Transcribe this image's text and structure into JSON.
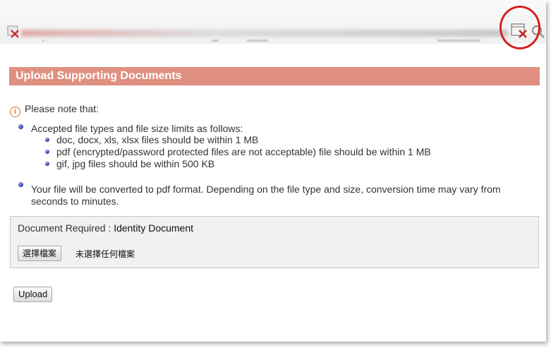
{
  "dialog": {
    "title": "Upload Supporting Documents",
    "note_prefix": "Please note that:"
  },
  "list": {
    "item1": "Accepted file types and file size limits as follows:",
    "sub_items": [
      "doc, docx, xls, xlsx files should be within 1 MB",
      "pdf (encrypted/password protected files are not acceptable) file should be within 1 MB",
      "gif, jpg files should be within 500 KB"
    ],
    "item2": "Your file will be converted to pdf format. Depending on the file type and size, conversion time may vary from seconds to minutes."
  },
  "document": {
    "label": "Document Required : ",
    "value": "Identity Document",
    "choose_button": "選擇檔案",
    "no_file_text": "未選擇任何檔案"
  },
  "actions": {
    "upload_label": "Upload"
  },
  "colors": {
    "header_bg": "#e09080",
    "highlight": "#d42020",
    "info": "#e06a1a"
  },
  "icons": [
    "close-icon",
    "close-window-icon",
    "search-icon",
    "info-icon",
    "bullet-icon"
  ]
}
